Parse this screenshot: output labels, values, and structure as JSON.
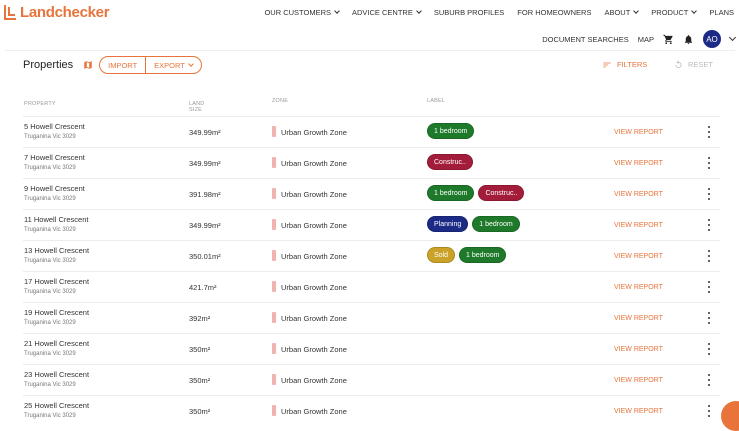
{
  "brand": {
    "name": "Landchecker",
    "accent": "#e8743b"
  },
  "nav_primary": [
    {
      "label": "OUR CUSTOMERS",
      "caret": true
    },
    {
      "label": "ADVICE CENTRE",
      "caret": true
    },
    {
      "label": "SUBURB PROFILES",
      "caret": false
    },
    {
      "label": "FOR HOMEOWNERS",
      "caret": false
    },
    {
      "label": "ABOUT",
      "caret": true
    },
    {
      "label": "PRODUCT",
      "caret": true
    },
    {
      "label": "PLANS",
      "caret": false
    }
  ],
  "nav_secondary": {
    "document_searches": "DOCUMENT SEARCHES",
    "map": "MAP",
    "avatar_initials": "AO"
  },
  "toolbar": {
    "title": "Properties",
    "import_label": "IMPORT",
    "export_label": "EXPORT",
    "filters_label": "FILTERS",
    "reset_label": "RESET"
  },
  "table": {
    "headers": {
      "property": "PROPERTY",
      "land_size": "LAND SIZE",
      "zone": "ZONE",
      "label": "LABEL"
    },
    "view_report_label": "VIEW REPORT",
    "rows": [
      {
        "address": "5 Howell Crescent",
        "suburb": "Truganina Vic 3029",
        "land_size": "349.99m²",
        "zone": "Urban Growth Zone",
        "labels": [
          {
            "text": "1 bedroom",
            "color": "#1e7a2a"
          }
        ]
      },
      {
        "address": "7 Howell Crescent",
        "suburb": "Truganina Vic 3029",
        "land_size": "349.99m²",
        "zone": "Urban Growth Zone",
        "labels": [
          {
            "text": "Construc..",
            "color": "#a31d3a"
          }
        ]
      },
      {
        "address": "9 Howell Crescent",
        "suburb": "Truganina Vic 3029",
        "land_size": "391.98m²",
        "zone": "Urban Growth Zone",
        "labels": [
          {
            "text": "1 bedroom",
            "color": "#1e7a2a"
          },
          {
            "text": "Construc..",
            "color": "#a31d3a"
          }
        ]
      },
      {
        "address": "11 Howell Crescent",
        "suburb": "Truganina Vic 3029",
        "land_size": "349.99m²",
        "zone": "Urban Growth Zone",
        "labels": [
          {
            "text": "Planning",
            "color": "#1b2a84"
          },
          {
            "text": "1 bedroom",
            "color": "#1e7a2a"
          }
        ]
      },
      {
        "address": "13 Howell Crescent",
        "suburb": "Truganina Vic 3029",
        "land_size": "350.01m²",
        "zone": "Urban Growth Zone",
        "labels": [
          {
            "text": "Sold",
            "color": "#c9a227"
          },
          {
            "text": "1 bedroom",
            "color": "#1e7a2a"
          }
        ]
      },
      {
        "address": "17 Howell Crescent",
        "suburb": "Truganina Vic 3029",
        "land_size": "421.7m²",
        "zone": "Urban Growth Zone",
        "labels": []
      },
      {
        "address": "19 Howell Crescent",
        "suburb": "Truganina Vic 3029",
        "land_size": "392m²",
        "zone": "Urban Growth Zone",
        "labels": []
      },
      {
        "address": "21 Howell Crescent",
        "suburb": "Truganina Vic 3029",
        "land_size": "350m²",
        "zone": "Urban Growth Zone",
        "labels": []
      },
      {
        "address": "23 Howell Crescent",
        "suburb": "Truganina Vic 3029",
        "land_size": "350m²",
        "zone": "Urban Growth Zone",
        "labels": []
      },
      {
        "address": "25 Howell Crescent",
        "suburb": "Truganina Vic 3029",
        "land_size": "350m²",
        "zone": "Urban Growth Zone",
        "labels": []
      }
    ]
  }
}
